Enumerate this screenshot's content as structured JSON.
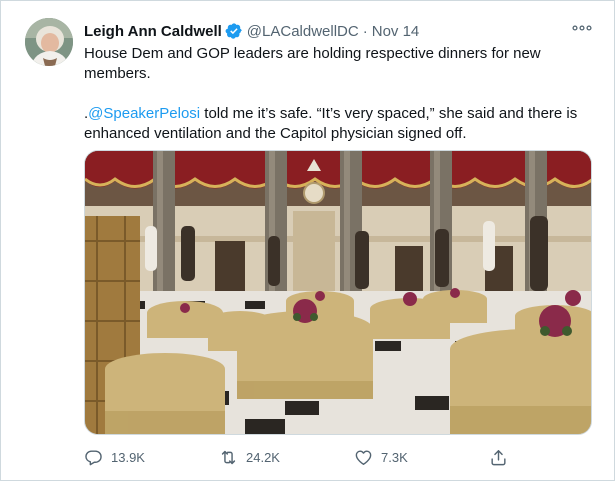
{
  "tweet": {
    "author_name": "Leigh Ann Caldwell",
    "handle": "@LACaldwellDC",
    "separator": "·",
    "date": "Nov 14",
    "text_line1": "House Dem and GOP leaders are holding respective dinners for new members.",
    "text_prefix": ".",
    "mention": "@SpeakerPelosi",
    "text_rest": " told me it’s safe. “It’s very spaced,” she said and there is enhanced ventilation and the Capitol physician signed off.",
    "verified_icon": "verified-badge-icon",
    "more_icon": "more-options-icon"
  },
  "actions": {
    "replies": "13.9K",
    "retweets": "24.2K",
    "likes": "7.3K"
  },
  "colors": {
    "link": "#1d9bf0",
    "secondary": "#536471",
    "verified": "#1d9bf0"
  }
}
